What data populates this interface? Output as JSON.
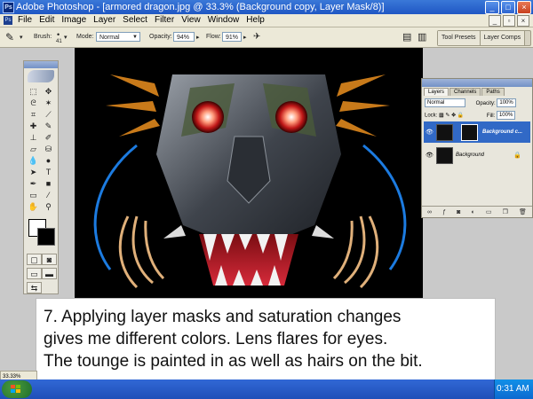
{
  "window": {
    "title": "Adobe Photoshop - [armored dragon.jpg @ 33.3% (Background copy, Layer Mask/8)]",
    "app_icon": "Ps",
    "min": "_",
    "max": "□",
    "close": "×"
  },
  "menubar": {
    "items": [
      "File",
      "Edit",
      "Image",
      "Layer",
      "Select",
      "Filter",
      "View",
      "Window",
      "Help"
    ],
    "mdi_min": "_",
    "mdi_restore": "▫",
    "mdi_close": "×"
  },
  "options": {
    "brush_label": "Brush:",
    "brush_size": "41",
    "mode_label": "Mode:",
    "mode_value": "Normal",
    "opacity_label": "Opacity:",
    "opacity_value": "94%",
    "flow_label": "Flow:",
    "flow_value": "91%",
    "tool_presets": "Tool Presets",
    "layer_comps": "Layer Comps"
  },
  "layers_panel": {
    "tabs": [
      "Layers",
      "Channels",
      "Paths"
    ],
    "blend_mode": "Normal",
    "opacity_label": "Opacity:",
    "opacity_value": "100%",
    "lock_label": "Lock:",
    "fill_label": "Fill:",
    "fill_value": "100%",
    "layers": [
      {
        "name": "Background c...",
        "selected": true
      },
      {
        "name": "Background",
        "selected": false
      }
    ]
  },
  "caption": {
    "lines": [
      "7. Applying layer masks and saturation changes",
      "gives me different colors. Lens flares for eyes.",
      "The tounge is painted in as well as hairs on the bit."
    ]
  },
  "status": {
    "zoom": "33.33%"
  },
  "taskbar": {
    "clock": "0:31 AM"
  },
  "colors": {
    "titlebar": "#2a66cf",
    "taskbar": "#245edb",
    "start": "#3a8a35",
    "selection": "#3169c6"
  }
}
